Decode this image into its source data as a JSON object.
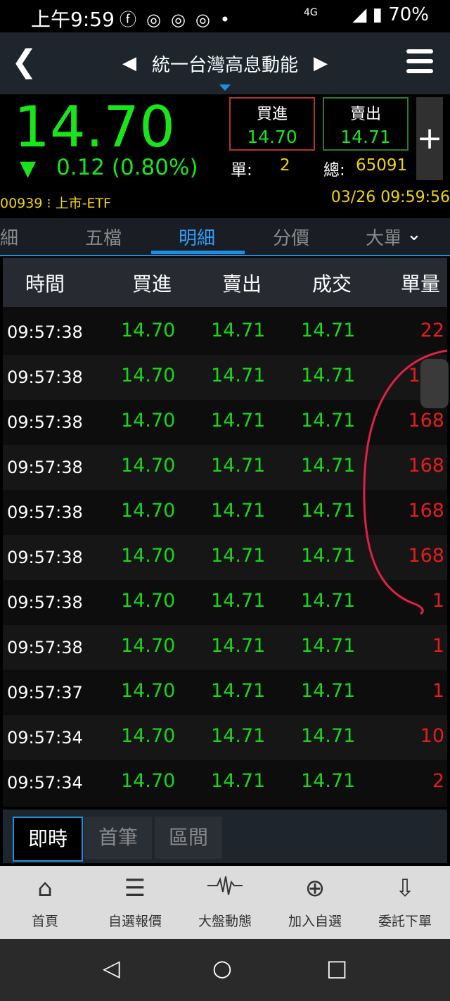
{
  "status": {
    "time": "上午9:59",
    "battery": "70%",
    "network": "4G"
  },
  "header": {
    "back_icon": "back-chevron-icon",
    "title": "統一台灣高息動能"
  },
  "quote": {
    "price": "14.70",
    "change": "0.12",
    "change_pct": "(0.80%)",
    "buy_label": "買進",
    "buy_price": "14.70",
    "sell_label": "賣出",
    "sell_price": "14.71",
    "single_label": "單:",
    "single_value": "2",
    "total_label": "總:",
    "total_value": "65091",
    "code": "00939",
    "market": "上市-ETF",
    "datetime": "03/26 09:59:56",
    "up_color": "#19e619"
  },
  "tabs": [
    "詳細",
    "五檔",
    "明細",
    "分價",
    "大單"
  ],
  "active_tab": 2,
  "table": {
    "headers": [
      "時間",
      "買進",
      "賣出",
      "成交",
      "單量"
    ],
    "rows": [
      {
        "time": "09:57:38",
        "bid": "14.70",
        "ask": "14.71",
        "deal": "14.71",
        "qty": "22"
      },
      {
        "time": "09:57:38",
        "bid": "14.70",
        "ask": "14.71",
        "deal": "14.71",
        "qty": "168"
      },
      {
        "time": "09:57:38",
        "bid": "14.70",
        "ask": "14.71",
        "deal": "14.71",
        "qty": "168"
      },
      {
        "time": "09:57:38",
        "bid": "14.70",
        "ask": "14.71",
        "deal": "14.71",
        "qty": "168"
      },
      {
        "time": "09:57:38",
        "bid": "14.70",
        "ask": "14.71",
        "deal": "14.71",
        "qty": "168"
      },
      {
        "time": "09:57:38",
        "bid": "14.70",
        "ask": "14.71",
        "deal": "14.71",
        "qty": "168"
      },
      {
        "time": "09:57:38",
        "bid": "14.70",
        "ask": "14.71",
        "deal": "14.71",
        "qty": "1"
      },
      {
        "time": "09:57:38",
        "bid": "14.70",
        "ask": "14.71",
        "deal": "14.71",
        "qty": "1"
      },
      {
        "time": "09:57:37",
        "bid": "14.70",
        "ask": "14.71",
        "deal": "14.71",
        "qty": "1"
      },
      {
        "time": "09:57:34",
        "bid": "14.70",
        "ask": "14.71",
        "deal": "14.71",
        "qty": "10"
      },
      {
        "time": "09:57:34",
        "bid": "14.70",
        "ask": "14.71",
        "deal": "14.71",
        "qty": "2"
      }
    ]
  },
  "segments": [
    "即時",
    "首筆",
    "區間"
  ],
  "active_segment": 0,
  "nav": [
    {
      "label": "首頁",
      "icon": "home-icon"
    },
    {
      "label": "自選報價",
      "icon": "list-icon"
    },
    {
      "label": "大盤動態",
      "icon": "pulse-icon"
    },
    {
      "label": "加入自選",
      "icon": "add-circle-icon"
    },
    {
      "label": "委託下單",
      "icon": "order-download-icon"
    }
  ]
}
